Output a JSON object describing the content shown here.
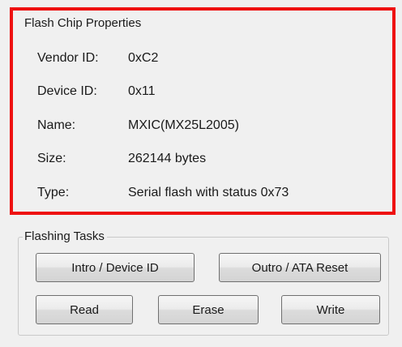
{
  "flash_chip_properties": {
    "title": "Flash Chip Properties",
    "vendor_id": {
      "label": "Vendor ID:",
      "value": "0xC2"
    },
    "device_id": {
      "label": "Device ID:",
      "value": "0x11"
    },
    "name": {
      "label": "Name:",
      "value": "MXIC(MX25L2005)"
    },
    "size": {
      "label": "Size:",
      "value": "262144 bytes"
    },
    "type": {
      "label": "Type:",
      "value": "Serial flash with status 0x73"
    }
  },
  "flashing_tasks": {
    "title": "Flashing Tasks",
    "intro_label": "Intro / Device ID",
    "outro_label": "Outro / ATA Reset",
    "read_label": "Read",
    "erase_label": "Erase",
    "write_label": "Write"
  },
  "colors": {
    "highlight_border": "#ee1111",
    "panel_background": "#f0f0f0"
  }
}
